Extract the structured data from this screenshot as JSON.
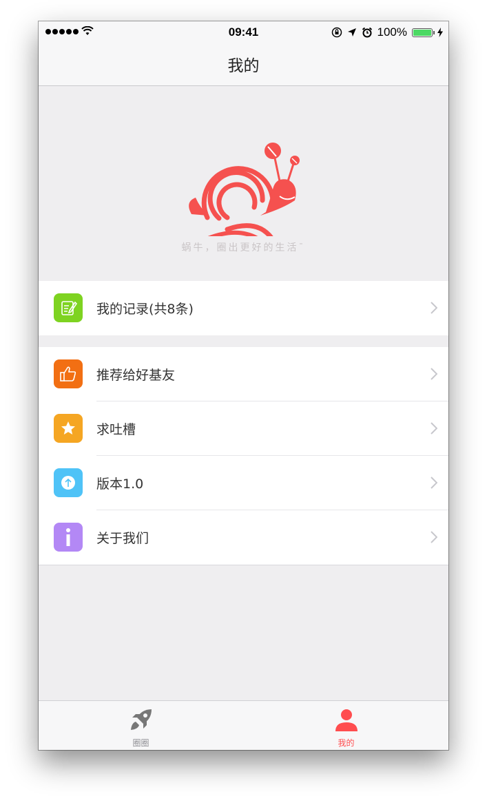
{
  "status": {
    "time": "09:41",
    "battery": "100%"
  },
  "nav": {
    "title": "我的"
  },
  "header": {
    "slogan": "蜗牛，圈出更好的生活ˉ"
  },
  "menu": {
    "records": {
      "label": "我的记录(共8条)",
      "icon": "notepad-icon",
      "color": "#7ed321"
    },
    "items": [
      {
        "label": "推荐给好基友",
        "icon": "thumbs-up-icon",
        "color": "#f26f13"
      },
      {
        "label": "求吐槽",
        "icon": "star-icon",
        "color": "#f5a623"
      },
      {
        "label": "版本1.0",
        "icon": "upload-icon",
        "color": "#4fc3f7"
      },
      {
        "label": "关于我们",
        "icon": "info-icon",
        "color": "#b388f5"
      }
    ]
  },
  "tabbar": {
    "tabs": [
      {
        "label": "圈圈",
        "icon": "rocket-icon",
        "active": false
      },
      {
        "label": "我的",
        "icon": "person-icon",
        "active": true
      }
    ],
    "active_color": "#ff4d4f",
    "inactive_color": "#8e8e93"
  }
}
